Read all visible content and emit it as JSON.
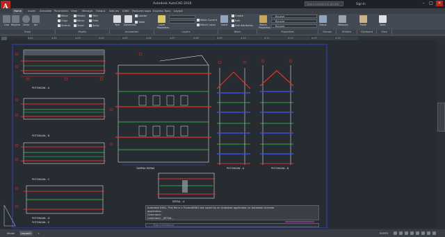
{
  "app": {
    "logo_letter": "A",
    "title": "Autodesk AutoCAD 2016",
    "search_placeholder": "Type a keyword or phrase",
    "signin": "Sign In"
  },
  "ribbon_tabs": [
    "Home",
    "Insert",
    "Annotate",
    "Parametric",
    "View",
    "Manage",
    "Output",
    "Add-ins",
    "A360",
    "Featured Apps",
    "Express Tools",
    "Layout"
  ],
  "ribbon": {
    "draw_tools": [
      "Line",
      "Polyline",
      "Circle",
      "Arc"
    ],
    "modify_tools": [
      "Move",
      "Rotate",
      "Trim",
      "Copy",
      "Mirror",
      "Fillet",
      "Stretch",
      "Scale",
      "Array"
    ],
    "annotation_tools": [
      "Text",
      "Dimension",
      "Leader",
      "Table"
    ],
    "layer_tools": [
      "Layer Properties",
      "Make Current",
      "Match Layer"
    ],
    "block_tools": [
      "Insert",
      "Create",
      "Edit",
      "Edit Attributes"
    ],
    "properties_tools": [
      "Match Properties"
    ],
    "properties_dropdowns": [
      "ByLayer",
      "ByLayer",
      "ByLayer"
    ],
    "right_tools": [
      "Group",
      "Measure",
      "Paste",
      "Base"
    ],
    "groups": [
      "Draw",
      "Modify",
      "Annotation",
      "Layers",
      "Block",
      "Properties",
      "Groups",
      "Utilities",
      "Clipboard",
      "View"
    ]
  },
  "file_tabs": [
    "A-01",
    "A-02",
    "A-03",
    "A-04",
    "A-05",
    "A-06",
    "A-07",
    "A-08",
    "A-09",
    "A-10",
    "A-11",
    "A-12",
    "A-13",
    "A-14"
  ],
  "drawing": {
    "labels": [
      "POTONGAN - A",
      "POTONGAN - B",
      "POTONGAN - C",
      "POTONGAN - D",
      "POTONGAN - E",
      "TAMPAK DEPAN",
      "DETAIL - A",
      "POTONGAN - A",
      "POTONGAN - B"
    ]
  },
  "command": {
    "lines": [
      "Autodesk DWG.  This file is a TrustedDWG last saved by an Autodesk application or Autodesk licensed",
      "application.",
      "Command:",
      "Command:  _DETAIL..."
    ],
    "input_placeholder": "Type a command"
  },
  "status": {
    "layout_tabs": [
      "Model",
      "Layout1",
      "+"
    ],
    "paper_label": "PAPER"
  },
  "colors": {
    "accent_red": "#b8251d",
    "drawing_red": "#e5322b",
    "drawing_green": "#39d648",
    "drawing_blue": "#3a4ee0",
    "drawing_white": "#dfe3e8"
  }
}
